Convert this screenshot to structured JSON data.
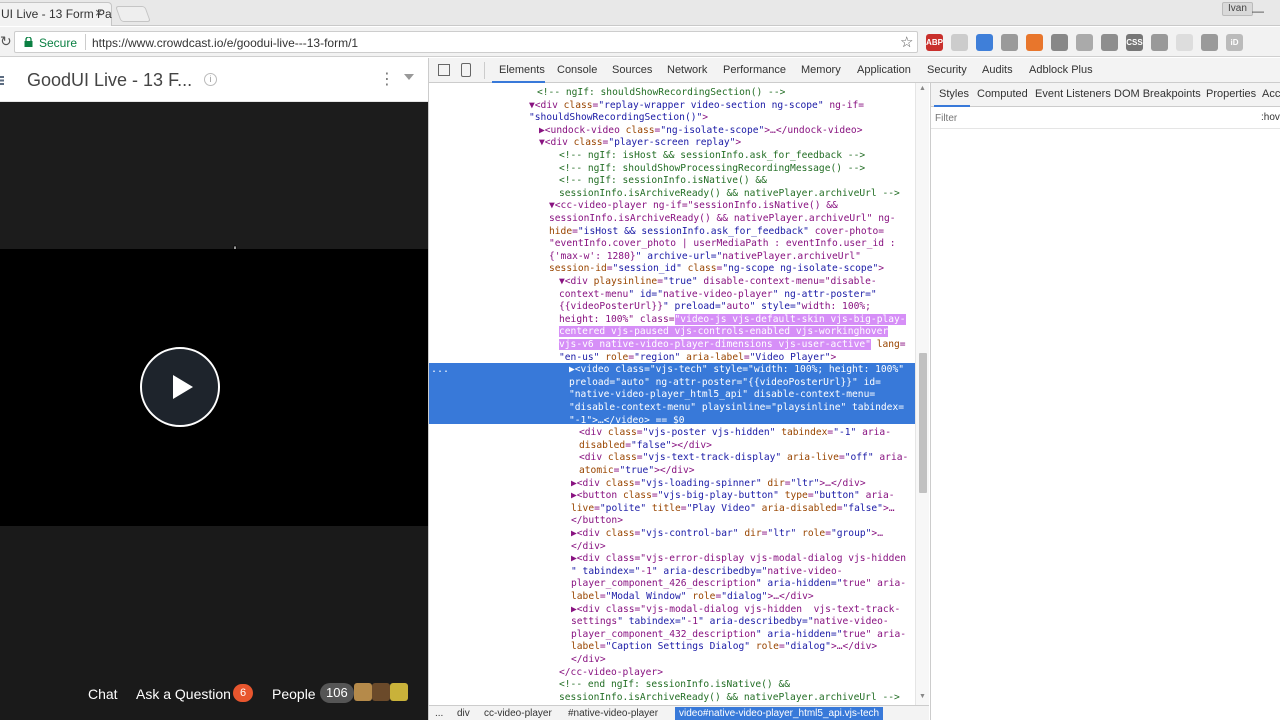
{
  "browser": {
    "tab_title": "UI Live - 13 Form Pa",
    "tab_close": "×",
    "profile": "Ivan",
    "minimize": "—",
    "url_secure": "Secure",
    "url": "https://www.crowdcast.io/e/goodui-live---13-form/1",
    "extensions": [
      {
        "name": "adblock-icon",
        "label": "ABP",
        "color": "#c9302c"
      },
      {
        "name": "ext-gray-icon",
        "label": "",
        "color": "#cccccc"
      },
      {
        "name": "color-wheel-icon",
        "label": "",
        "color": "#3f7fd9"
      },
      {
        "name": "ext-settings-icon",
        "label": "",
        "color": "#9a9a9a"
      },
      {
        "name": "ext-orange-icon",
        "label": "",
        "color": "#e8762c"
      },
      {
        "name": "ext-dark-icon",
        "label": "",
        "color": "#888888"
      },
      {
        "name": "puzzle-icon",
        "label": "",
        "color": "#aaaaaa"
      },
      {
        "name": "download-icon",
        "label": "",
        "color": "#8e8e8e"
      },
      {
        "name": "css-icon",
        "label": "CSS",
        "color": "#777777"
      },
      {
        "name": "recycle-icon",
        "label": "",
        "color": "#999999"
      },
      {
        "name": "ext-light-icon",
        "label": "",
        "color": "#dddddd"
      },
      {
        "name": "ext-box-icon",
        "label": "",
        "color": "#9a9a9a"
      },
      {
        "name": "id-icon",
        "label": "iD",
        "color": "#bbbbbb"
      }
    ]
  },
  "page": {
    "title": "GoodUI Live - 13 F...",
    "info": "i",
    "kebab": "⋮",
    "bottom": {
      "chat": "Chat",
      "ask": "Ask a Question",
      "ask_count": "6",
      "people": "People",
      "people_count": "106"
    }
  },
  "devtools": {
    "tabs": [
      "Elements",
      "Console",
      "Sources",
      "Network",
      "Performance",
      "Memory",
      "Application",
      "Security",
      "Audits",
      "Adblock Plus"
    ],
    "styles_tabs": [
      "Styles",
      "Computed",
      "Event Listeners",
      "DOM Breakpoints",
      "Properties",
      "Accessibility"
    ],
    "filter_placeholder": "Filter",
    "hov": ":hov",
    "selected_dots": "...",
    "breadcrumbs": [
      "...",
      "div",
      "cc-video-player",
      "#native-video-player",
      "video#native-video-player_html5_api.vjs-tech"
    ],
    "code": [
      "<!-- ngIf: shouldShowRecordingSection() -->",
      "▼<div class=\"replay-wrapper video-section ng-scope\" ng-if=",
      "\"shouldShowRecordingSection()\">",
      "▶<undock-video class=\"ng-isolate-scope\">…</undock-video>",
      "▼<div class=\"player-screen replay\">",
      "<!-- ngIf: isHost && sessionInfo.ask_for_feedback -->",
      "<!-- ngIf: shouldShowProcessingRecordingMessage() -->",
      "<!-- ngIf: sessionInfo.isNative() &&",
      "sessionInfo.isArchiveReady() && nativePlayer.archiveUrl -->",
      "▼<cc-video-player ng-if=\"sessionInfo.isNative() &&",
      "sessionInfo.isArchiveReady() && nativePlayer.archiveUrl\" ng-",
      "hide=\"isHost && sessionInfo.ask_for_feedback\" cover-photo=",
      "\"eventInfo.cover_photo | userMediaPath : eventInfo.user_id :",
      "{'max-w': 1280}\" archive-url=\"nativePlayer.archiveUrl\"",
      "session-id=\"session_id\" class=\"ng-scope ng-isolate-scope\">",
      "▼<div playsinline=\"true\" disable-context-menu=\"disable-",
      "context-menu\" id=\"native-video-player\" ng-attr-poster=\"",
      "{{videoPosterUrl}}\" preload=\"auto\" style=\"width: 100%;",
      "height: 100%\" class=\"video-js vjs-default-skin vjs-big-play-",
      "centered vjs-paused vjs-controls-enabled vjs-workinghover",
      "vjs-v6 native-video-player-dimensions vjs-user-active\" lang=",
      "\"en-us\" role=\"region\" aria-label=\"Video Player\">",
      "▶<video class=\"vjs-tech\" style=\"width: 100%; height: 100%\"",
      "preload=\"auto\" ng-attr-poster=\"{{videoPosterUrl}}\" id=",
      "\"native-video-player_html5_api\" disable-context-menu=",
      "\"disable-context-menu\" playsinline=\"playsinline\" tabindex=",
      "\"-1\">…</video> == $0",
      "<div class=\"vjs-poster vjs-hidden\" tabindex=\"-1\" aria-",
      "disabled=\"false\"></div>",
      "<div class=\"vjs-text-track-display\" aria-live=\"off\" aria-",
      "atomic=\"true\"></div>",
      "▶<div class=\"vjs-loading-spinner\" dir=\"ltr\">…</div>",
      "▶<button class=\"vjs-big-play-button\" type=\"button\" aria-",
      "live=\"polite\" title=\"Play Video\" aria-disabled=\"false\">…",
      "</button>",
      "▶<div class=\"vjs-control-bar\" dir=\"ltr\" role=\"group\">…",
      "</div>",
      "▶<div class=\"vjs-error-display vjs-modal-dialog vjs-hidden",
      "\" tabindex=\"-1\" aria-describedby=\"native-video-",
      "player_component_426_description\" aria-hidden=\"true\" aria-",
      "label=\"Modal Window\" role=\"dialog\">…</div>",
      "▶<div class=\"vjs-modal-dialog vjs-hidden  vjs-text-track-",
      "settings\" tabindex=\"-1\" aria-describedby=\"native-video-",
      "player_component_432_description\" aria-hidden=\"true\" aria-",
      "label=\"Caption Settings Dialog\" role=\"dialog\">…</div>",
      "</div>",
      "</cc-video-player>",
      "<!-- end ngIf: sessionInfo.isNative() &&",
      "sessionInfo.isArchiveReady() && nativePlayer.archiveUrl -->"
    ]
  },
  "colors": {
    "selection": "#3879d9",
    "highlight": "#d68ff7",
    "badge": "#e8562e"
  }
}
